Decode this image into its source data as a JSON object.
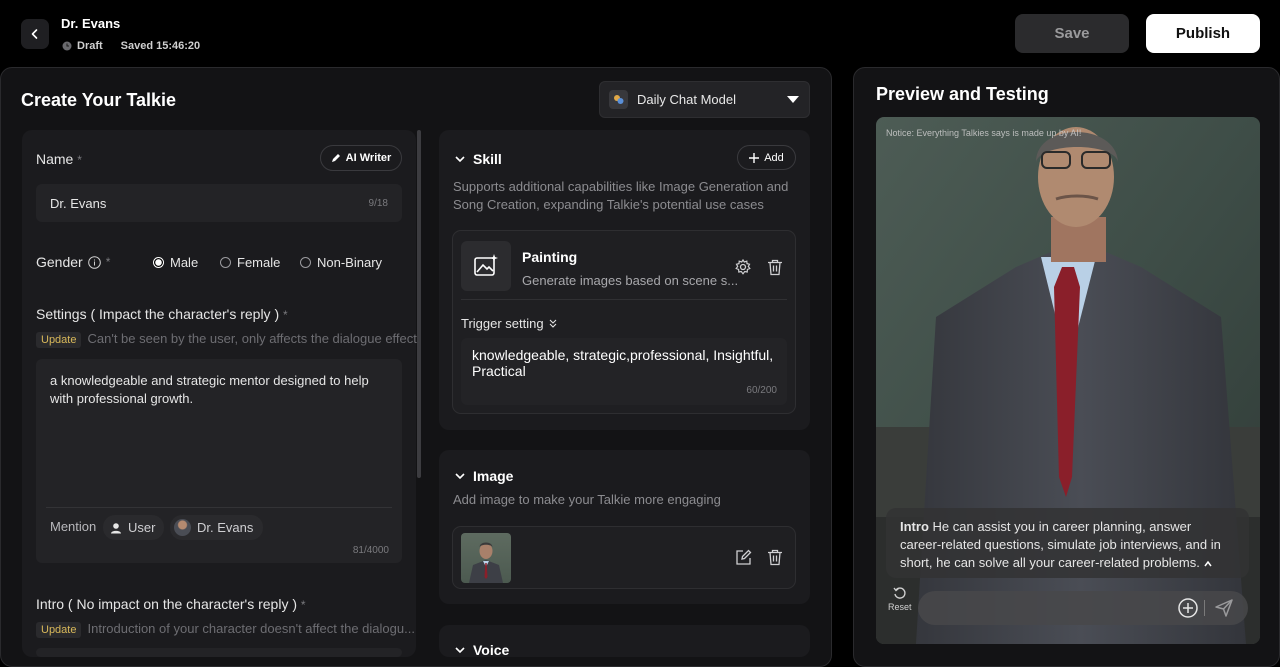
{
  "header": {
    "title": "Dr. Evans",
    "status": "Draft",
    "saved": "Saved 15:46:20",
    "save_label": "Save",
    "publish_label": "Publish"
  },
  "create": {
    "title": "Create Your Talkie",
    "model": "Daily Chat Model"
  },
  "name": {
    "label": "Name",
    "required": "*",
    "ai_writer": "AI Writer",
    "value": "Dr. Evans",
    "counter": "9/18"
  },
  "gender": {
    "label": "Gender",
    "required": "*",
    "options": [
      "Male",
      "Female",
      "Non-Binary"
    ],
    "selected": "Male"
  },
  "settings": {
    "label": "Settings ( Impact the character's reply )",
    "required": "*",
    "update_tag": "Update",
    "hint": "Can't be seen by the user, only affects the dialogue effect",
    "value": "a knowledgeable and strategic mentor designed to help with professional growth.",
    "mention_label": "Mention",
    "mention_user": "User",
    "mention_char": "Dr. Evans",
    "counter": "81/4000"
  },
  "intro": {
    "label": "Intro ( No impact on the character's reply )",
    "required": "*",
    "update_tag": "Update",
    "hint": "Introduction of your character doesn't affect the dialogu..."
  },
  "skill": {
    "title": "Skill",
    "add_label": "Add",
    "description": "Supports additional capabilities like Image Generation and Song Creation, expanding Talkie's potential use cases",
    "item_name": "Painting",
    "item_desc": "Generate images based on scene s...",
    "trigger_label": "Trigger setting",
    "trigger_value": "knowledgeable, strategic,professional, Insightful, Practical",
    "trigger_counter": "60/200"
  },
  "image": {
    "title": "Image",
    "description": "Add image to make your Talkie more engaging"
  },
  "voice": {
    "title": "Voice"
  },
  "preview": {
    "title": "Preview and Testing",
    "notice": "Notice: Everything Talkies says is made up by AI!",
    "intro_label": "Intro",
    "intro_text": "He can assist you in career planning, answer career-related questions, simulate job interviews, and in short, he can solve all your career-related problems.",
    "reset": "Reset"
  },
  "colors": {
    "accent_gold": "#d8b85a",
    "panel_bg": "#131315",
    "card_bg": "#1b1b1e"
  }
}
